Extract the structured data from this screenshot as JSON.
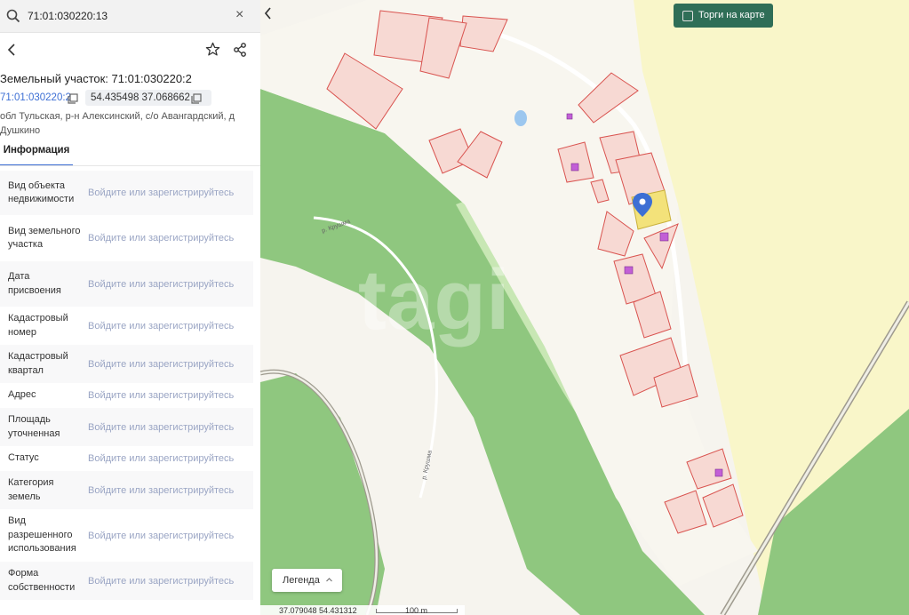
{
  "search": {
    "value": "71:01:030220:13",
    "clear": "×"
  },
  "parcel": {
    "title": "Земельный участок: 71:01:030220:2",
    "cadastral_link": "71:01:030220:2",
    "coordinates": "54.435498 37.068662",
    "address": "обл Тульская, р-н Алексинский, с/о Авангардский, д Душкино"
  },
  "tabs": [
    {
      "label": "Информация"
    }
  ],
  "login_prompt": "Войдите или зарегистрируйтесь",
  "properties": [
    {
      "label": "Вид объекта недвижимости"
    },
    {
      "label": "Вид земельного участка"
    },
    {
      "label": "Дата присвоения"
    },
    {
      "label": "Кадастровый номер"
    },
    {
      "label": "Кадастровый квартал"
    },
    {
      "label": "Адрес"
    },
    {
      "label": "Площадь уточненная"
    },
    {
      "label": "Статус"
    },
    {
      "label": "Категория земель"
    },
    {
      "label": "Вид разрешенного использования"
    },
    {
      "label": "Форма собственности"
    }
  ],
  "map": {
    "torgi_label": "Торги на карте",
    "legend_label": "Легенда",
    "bottom_coords": "37.079048   54.431312",
    "scale_label": "100 m",
    "river_label_1": "р. Крушма",
    "river_label_2": "р. Крушма",
    "watermark": "tagi"
  },
  "colors": {
    "accent": "#3d6fd4",
    "torgi_bg": "#2f6e57",
    "forest": "#8fc77f",
    "parcel_fill": "#f7d9d3",
    "parcel_stroke": "#d9534f",
    "selected_parcel": "#f3e27a",
    "field": "#f9f6c9"
  },
  "icons": [
    "search-icon",
    "close-icon",
    "back-icon",
    "star-icon",
    "share-icon",
    "copy-icon",
    "chevron-left-icon",
    "chevron-up-icon",
    "location-pin-icon"
  ]
}
